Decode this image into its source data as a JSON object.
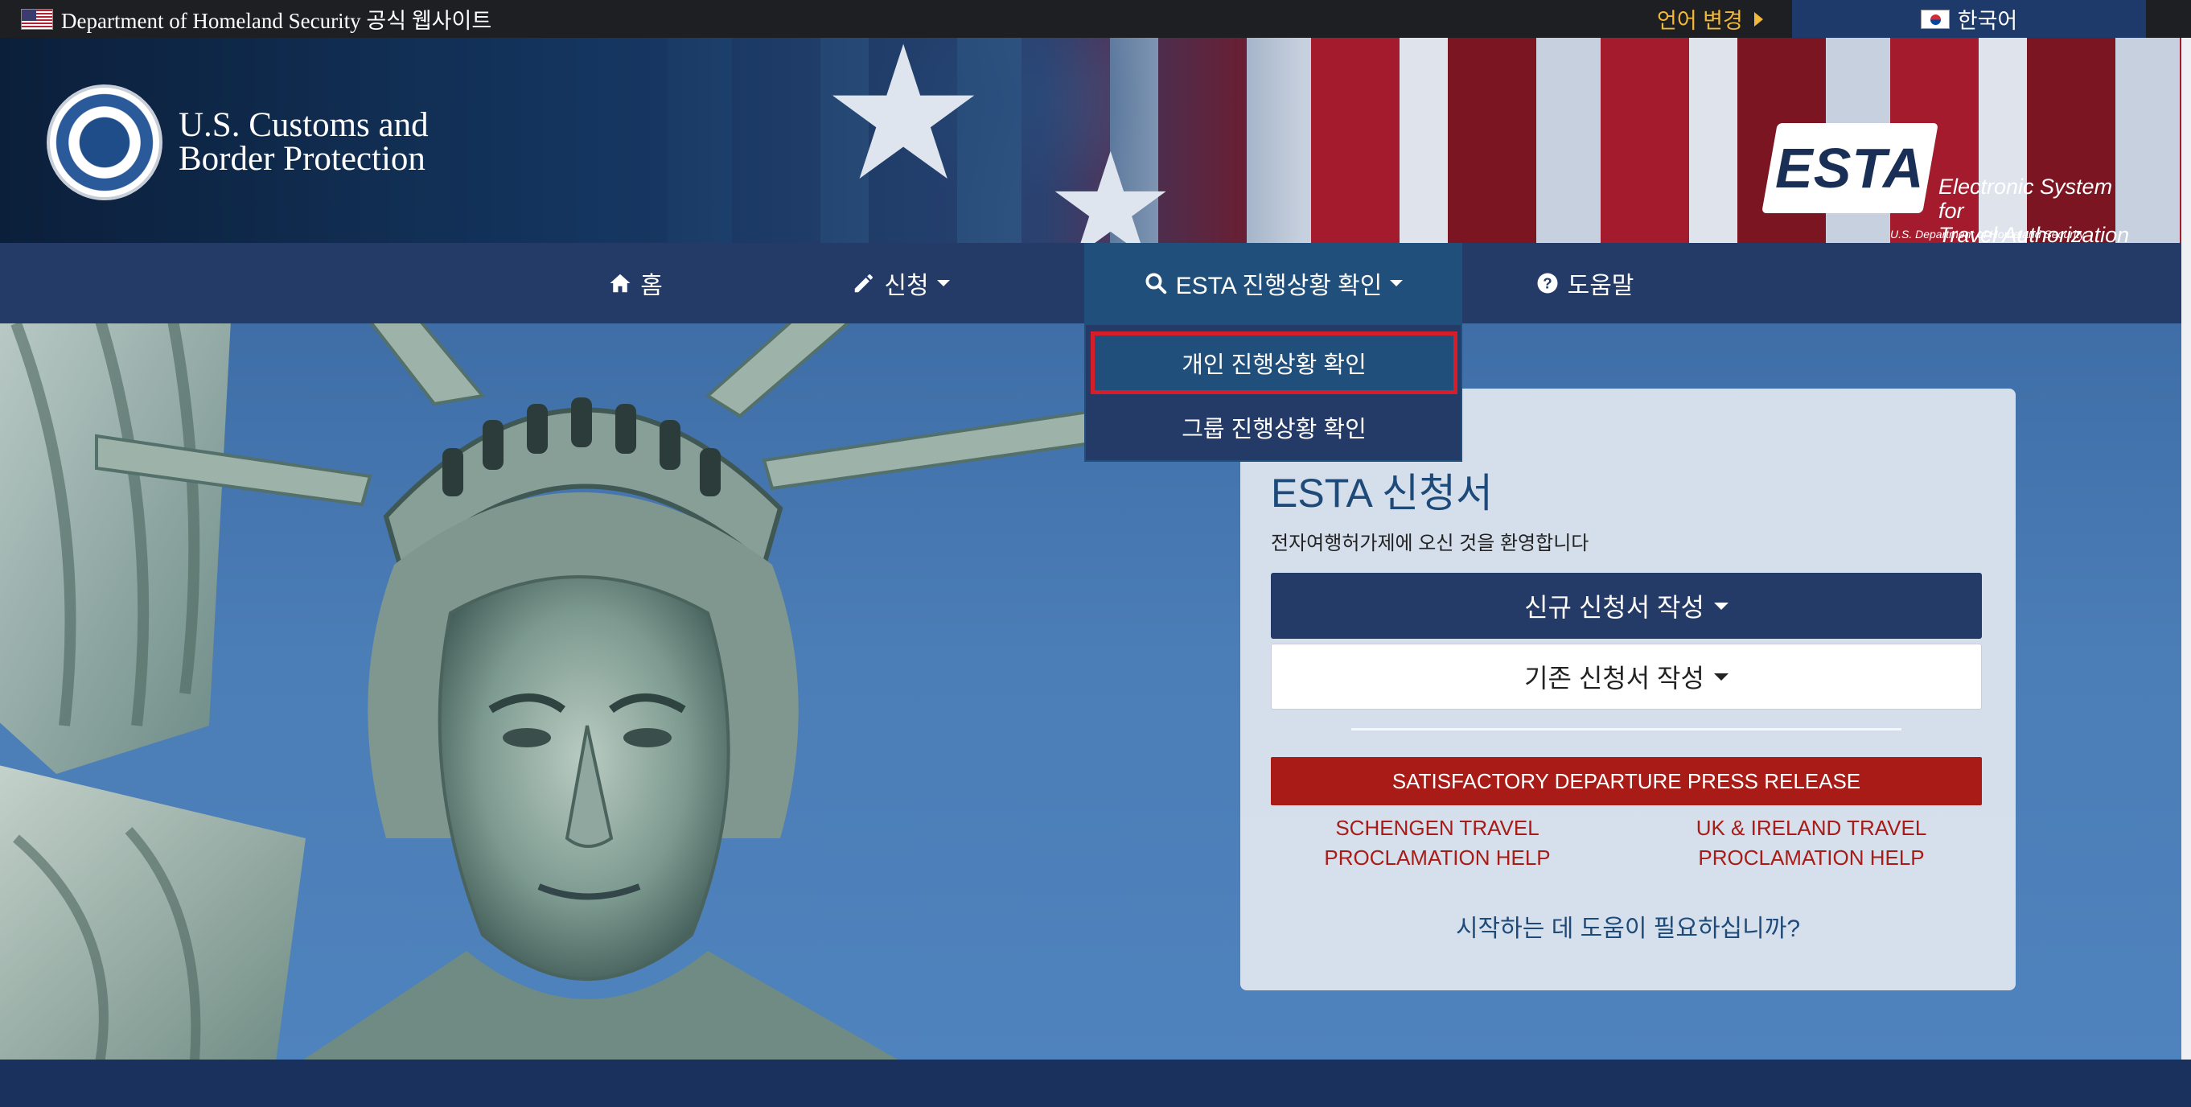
{
  "gov_banner": {
    "text": "Department of Homeland Security 공식 웹사이트",
    "language_change": "언어 변경",
    "current_language": "한국어"
  },
  "header": {
    "agency_line1": "U.S. Customs and",
    "agency_line2": "Border Protection",
    "esta_logo_word": "ESTA",
    "esta_full_line1": "Electronic System for",
    "esta_full_line2": "Travel Authorization",
    "esta_dept": "U.S. Department of Homeland Security"
  },
  "nav": {
    "home": "홈",
    "apply": "신청",
    "status": "ESTA 진행상황 확인",
    "help": "도움말"
  },
  "dropdown": {
    "items": [
      "개인 진행상황 확인",
      "그룹 진행상황 확인"
    ]
  },
  "panel": {
    "title": "ESTA 신청서",
    "welcome": "전자여행허가제에 오신 것을 환영합니다",
    "new_application": "신규 신청서 작성",
    "existing_application": "기존 신청서 작성",
    "sdp_button": "SATISFACTORY DEPARTURE PRESS RELEASE",
    "schengen_line1": "SCHENGEN TRAVEL",
    "schengen_line2": "PROCLAMATION HELP",
    "uk_line1": "UK & IRELAND TRAVEL",
    "uk_line2": "PROCLAMATION HELP",
    "help_link": "시작하는 데 도움이 필요하십니까?"
  },
  "colors": {
    "nav_bg": "#243b67",
    "nav_active": "#1f4f7a",
    "accent_red": "#a81b16",
    "highlight_border": "#d51e2a",
    "lang_gold": "#f1b83a"
  }
}
